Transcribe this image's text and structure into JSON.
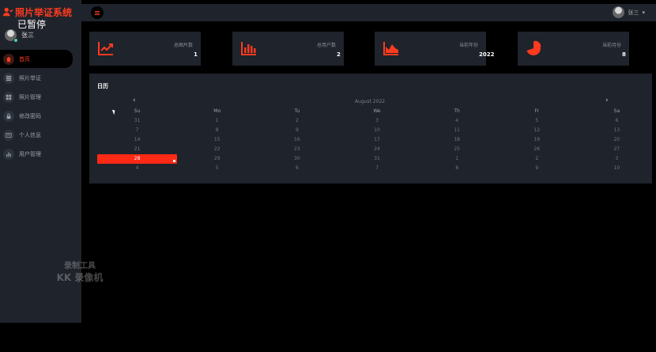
{
  "app": {
    "title": "照片举证系统",
    "paused": "已暂停"
  },
  "sidebar": {
    "user": "张三",
    "items": [
      {
        "label": "首页",
        "icon": "home-icon"
      },
      {
        "label": "照片举证",
        "icon": "grid-icon"
      },
      {
        "label": "照片管理",
        "icon": "grid-icon"
      },
      {
        "label": "修改密码",
        "icon": "lock-icon"
      },
      {
        "label": "个人信息",
        "icon": "id-card-icon"
      },
      {
        "label": "用户管理",
        "icon": "bar-chart-icon"
      }
    ]
  },
  "watermark": {
    "line1": "录制工具",
    "line2": "KK 录像机"
  },
  "topbar": {
    "user": "张三"
  },
  "cards": [
    {
      "label": "总图片数",
      "value": "1",
      "icon": "line-chart-icon"
    },
    {
      "label": "总用户数",
      "value": "2",
      "icon": "bar-chart-icon"
    },
    {
      "label": "当前年份",
      "value": "2022",
      "icon": "area-chart-icon"
    },
    {
      "label": "当前月份",
      "value": "8",
      "icon": "pie-chart-icon"
    }
  ],
  "calendar": {
    "title": "日历",
    "month": "August 2022",
    "prev": "‹",
    "next": "›",
    "weekdays": [
      "Su",
      "Mo",
      "Tu",
      "We",
      "Th",
      "Fr",
      "Sa"
    ],
    "weeks": [
      [
        "31",
        "1",
        "2",
        "3",
        "4",
        "5",
        "6"
      ],
      [
        "7",
        "8",
        "9",
        "10",
        "11",
        "12",
        "13"
      ],
      [
        "14",
        "15",
        "16",
        "17",
        "18",
        "19",
        "20"
      ],
      [
        "21",
        "22",
        "23",
        "24",
        "25",
        "26",
        "27"
      ],
      [
        "28",
        "29",
        "30",
        "31",
        "1",
        "2",
        "3"
      ],
      [
        "4",
        "5",
        "6",
        "7",
        "8",
        "9",
        "10"
      ]
    ],
    "selected": "28"
  },
  "colors": {
    "accent": "#ff3b1f",
    "panel": "#1f232b",
    "background": "#000000"
  }
}
